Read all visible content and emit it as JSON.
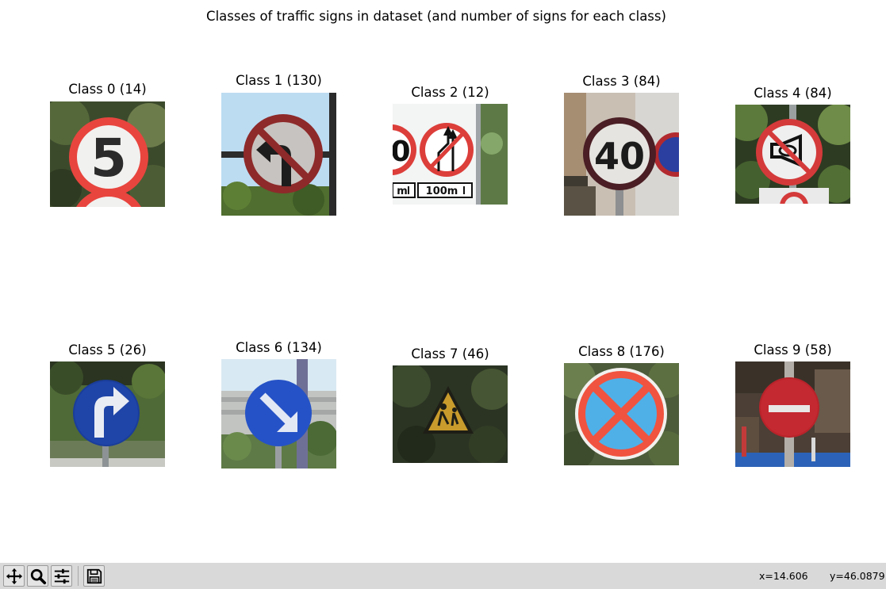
{
  "figure": {
    "suptitle": "Classes of traffic signs in dataset (and number of signs for each class)",
    "panels": [
      {
        "label": "Class 0 (14)",
        "icon": "speed-limit-5-sign-icon"
      },
      {
        "label": "Class 1 (130)",
        "icon": "no-left-turn-sign-icon"
      },
      {
        "label": "Class 2 (12)",
        "icon": "no-overtaking-sign-icon",
        "sign_text": [
          "0",
          "m",
          "100m"
        ]
      },
      {
        "label": "Class 3 (84)",
        "icon": "speed-limit-40-sign-icon"
      },
      {
        "label": "Class 4 (84)",
        "icon": "no-horn-sign-icon"
      },
      {
        "label": "Class 5 (26)",
        "icon": "turn-right-sign-icon"
      },
      {
        "label": "Class 6 (134)",
        "icon": "keep-right-sign-icon"
      },
      {
        "label": "Class 7 (46)",
        "icon": "pedestrian-warning-sign-icon"
      },
      {
        "label": "Class 8 (176)",
        "icon": "no-stopping-sign-icon"
      },
      {
        "label": "Class 9 (58)",
        "icon": "no-entry-sign-icon"
      }
    ]
  },
  "sign_digits": {
    "class0": "5",
    "class3": "40"
  },
  "toolbar": {
    "buttons": [
      {
        "name": "pan-button",
        "icon": "move-arrows-icon"
      },
      {
        "name": "zoom-button",
        "icon": "magnifier-icon"
      },
      {
        "name": "configure-subplots-button",
        "icon": "sliders-icon"
      },
      {
        "name": "save-button",
        "icon": "floppy-disk-icon"
      }
    ],
    "coord_x": "x=14.606",
    "coord_y": "y=46.0879"
  },
  "colors": {
    "sign_red": "#d93b3b",
    "sign_blue": "#1f3fae",
    "toolbar_bg": "#d9d9d9"
  }
}
